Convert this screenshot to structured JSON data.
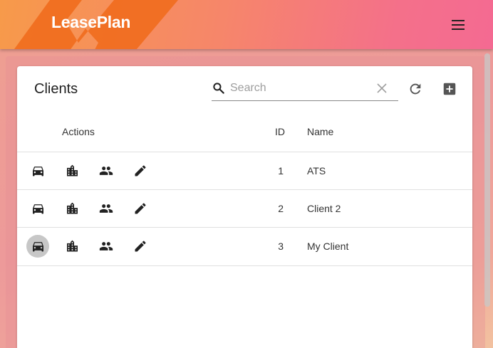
{
  "header": {
    "logo": "LeasePlan",
    "menu_icon": "menu-icon"
  },
  "table": {
    "title": "Clients",
    "search": {
      "placeholder": "Search",
      "value": ""
    },
    "columns": {
      "actions": "Actions",
      "id": "ID",
      "name": "Name"
    },
    "action_icons": [
      "car-icon",
      "building-icon",
      "people-icon",
      "edit-icon"
    ],
    "rows": [
      {
        "id": "1",
        "name": "ATS"
      },
      {
        "id": "2",
        "name": "Client 2"
      },
      {
        "id": "3",
        "name": "My Client"
      }
    ]
  },
  "colors": {
    "header_gradient_start": "#f79a4a",
    "header_gradient_end": "#f46a92",
    "card": "#ffffff",
    "icon": "#212121"
  }
}
